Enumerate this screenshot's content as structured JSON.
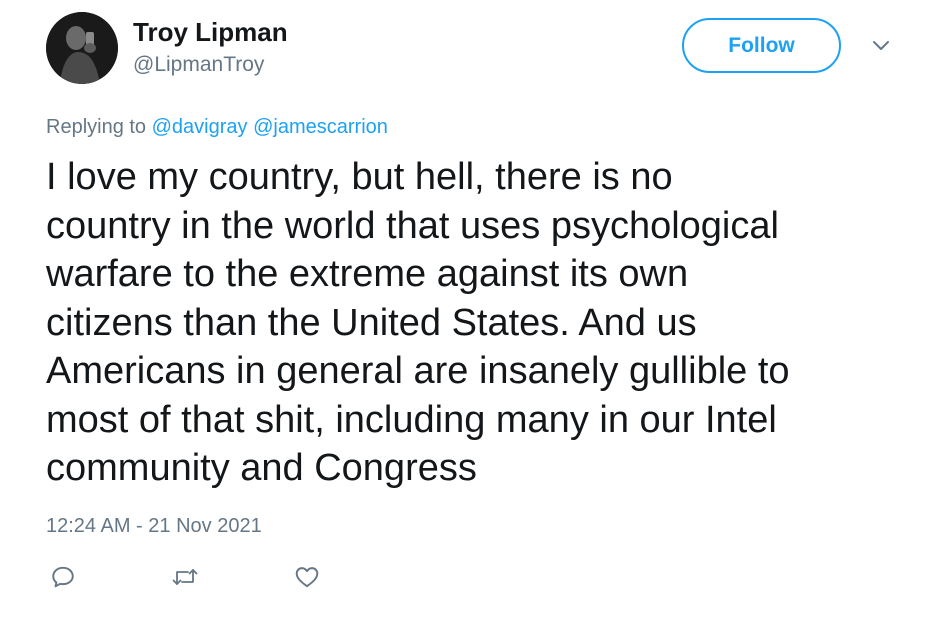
{
  "author": {
    "display_name": "Troy Lipman",
    "handle": "@LipmanTroy"
  },
  "follow_label": "Follow",
  "reply": {
    "prefix": "Replying to",
    "mentions": [
      "@davigray",
      "@jamescarrion"
    ]
  },
  "tweet": {
    "text": "I love my country, but hell, there is no\ncountry in the world that uses psychological\nwarfare to the extreme against its own\ncitizens than the United States. And us\nAmericans in general are insanely gullible to\nmost of that shit, including many in our Intel\ncommunity and Congress",
    "timestamp": "12:24 AM - 21 Nov 2021"
  },
  "actions": [
    {
      "icon": "reply-icon"
    },
    {
      "icon": "retweet-icon"
    },
    {
      "icon": "like-icon"
    }
  ],
  "colors": {
    "accent": "#1da1f2",
    "text": "#14171a",
    "secondary": "#657786",
    "icon": "#657786"
  }
}
